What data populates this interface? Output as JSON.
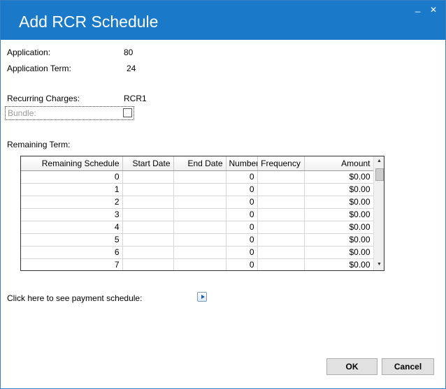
{
  "window": {
    "title": "Add RCR Schedule",
    "minimize_glyph": "_",
    "close_glyph": "✕"
  },
  "fields": {
    "application_label": "Application:",
    "application_value": "80",
    "application_term_label": "Application Term:",
    "application_term_value": "24",
    "recurring_charges_label": "Recurring Charges:",
    "recurring_charges_value": "RCR1",
    "bundle_label": "Bundle:",
    "bundle_checked": false,
    "remaining_term_label": "Remaining Term:"
  },
  "grid": {
    "columns": [
      "Remaining Schedule",
      "Start Date",
      "End Date",
      "Number",
      "Frequency",
      "Amount"
    ],
    "rows": [
      [
        "0",
        "",
        "",
        "0",
        "",
        "$0.00"
      ],
      [
        "1",
        "",
        "",
        "0",
        "",
        "$0.00"
      ],
      [
        "2",
        "",
        "",
        "0",
        "",
        "$0.00"
      ],
      [
        "3",
        "",
        "",
        "0",
        "",
        "$0.00"
      ],
      [
        "4",
        "",
        "",
        "0",
        "",
        "$0.00"
      ],
      [
        "5",
        "",
        "",
        "0",
        "",
        "$0.00"
      ],
      [
        "6",
        "",
        "",
        "0",
        "",
        "$0.00"
      ],
      [
        "7",
        "",
        "",
        "0",
        "",
        "$0.00"
      ]
    ],
    "scroll_up_glyph": "▲",
    "scroll_down_glyph": "▼"
  },
  "payment_schedule": {
    "label": "Click here to see payment schedule:",
    "icon": "play-arrow-icon"
  },
  "buttons": {
    "ok": "OK",
    "cancel": "Cancel"
  }
}
